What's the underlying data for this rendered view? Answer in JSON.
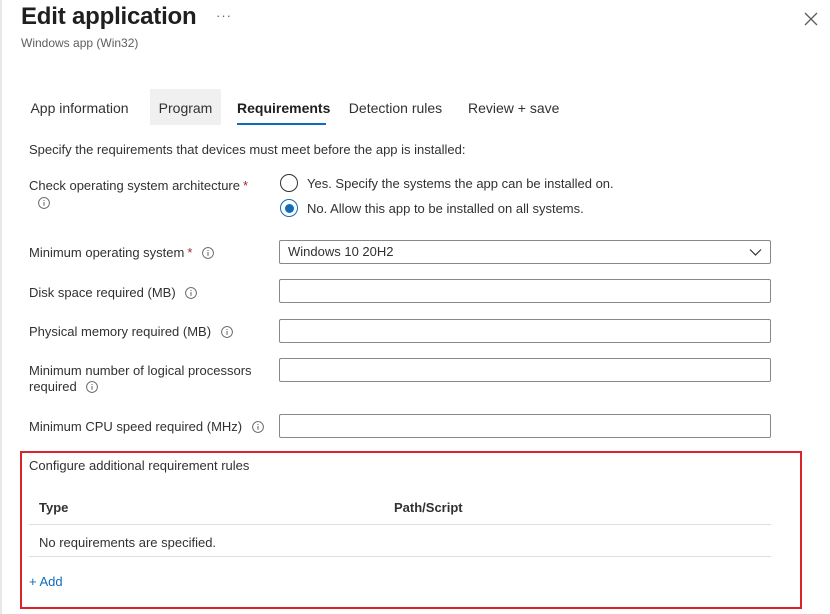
{
  "header": {
    "title": "Edit application",
    "more": "···",
    "subtitle": "Windows app (Win32)",
    "close_icon": "close-icon"
  },
  "tabs": [
    {
      "label": "App information",
      "state": "normal"
    },
    {
      "label": "Program",
      "state": "visited"
    },
    {
      "label": "Requirements",
      "state": "active"
    },
    {
      "label": "Detection rules",
      "state": "normal"
    },
    {
      "label": "Review + save",
      "state": "normal"
    }
  ],
  "intro": "Specify the requirements that devices must meet before the app is installed:",
  "os_arch": {
    "label": "Check operating system architecture",
    "required_mark": "*",
    "options": [
      {
        "label": "Yes. Specify the systems the app can be installed on.",
        "selected": false
      },
      {
        "label": "No. Allow this app to be installed on all systems.",
        "selected": true
      }
    ]
  },
  "min_os": {
    "label": "Minimum operating system",
    "required_mark": "*",
    "value": "Windows 10 20H2"
  },
  "disk_space": {
    "label": "Disk space required (MB)",
    "value": ""
  },
  "physical_memory": {
    "label": "Physical memory required (MB)",
    "value": ""
  },
  "processors": {
    "label_line1": "Minimum number of logical processors",
    "label_line2": "required",
    "value": ""
  },
  "cpu_speed": {
    "label": "Minimum CPU speed required (MHz)",
    "value": ""
  },
  "additional_rules": {
    "title": "Configure additional requirement rules",
    "columns": [
      "Type",
      "Path/Script"
    ],
    "empty_message": "No requirements are specified.",
    "add_label": "+ Add"
  },
  "colors": {
    "accent": "#0f6cbd",
    "required": "#a4262c",
    "highlight_border": "#d9242b"
  }
}
